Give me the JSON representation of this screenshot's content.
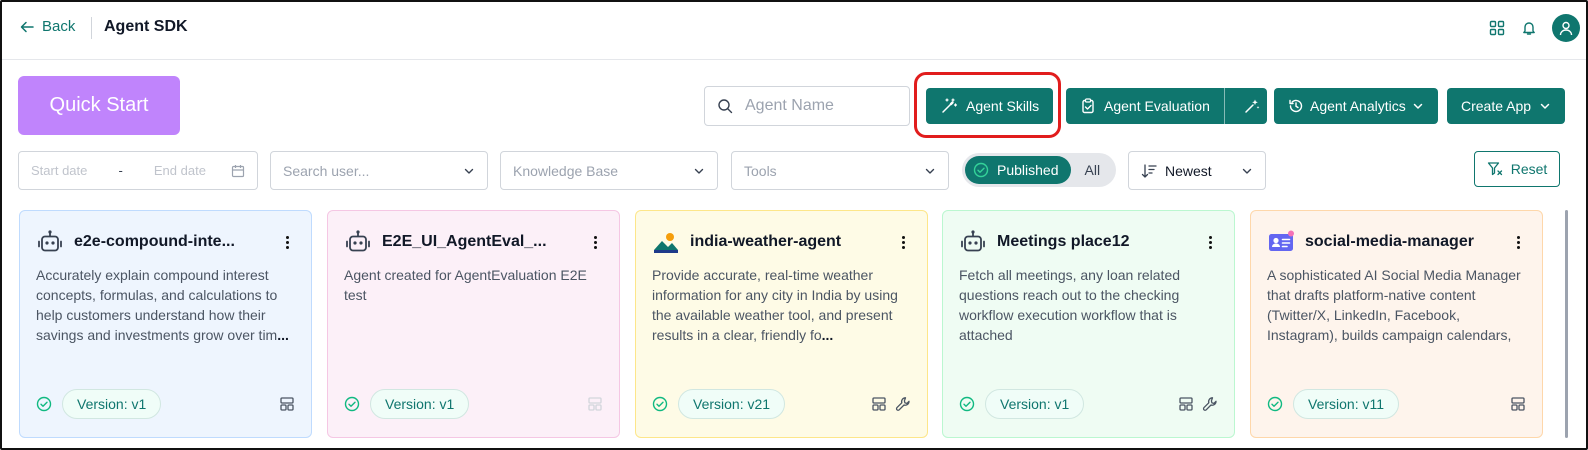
{
  "header": {
    "back_label": "Back",
    "title": "Agent SDK",
    "icons": [
      "grid-icon",
      "bell-icon",
      "user-icon"
    ]
  },
  "toolbar": {
    "quick_start": "Quick Start",
    "search_placeholder": "Agent Name",
    "agent_skills": "Agent Skills",
    "agent_evaluation": "Agent Evaluation",
    "agent_analytics": "Agent Analytics",
    "create_app": "Create App"
  },
  "filters": {
    "start_date_placeholder": "Start date",
    "date_separator": "-",
    "end_date_placeholder": "End date",
    "search_user_placeholder": "Search user...",
    "knowledge_base_placeholder": "Knowledge Base",
    "tools_placeholder": "Tools",
    "toggle_selected": "Published",
    "toggle_other": "All",
    "sort": "Newest",
    "reset": "Reset"
  },
  "cards": [
    {
      "name": "e2e-compound-inte...",
      "description": "Accurately explain compound interest concepts, formulas, and calculations to help customers understand how their savings and investments grow over tim",
      "more": "...",
      "version": "Version: v1",
      "icon": "robot-icon",
      "theme": "blue",
      "has_wrench": false
    },
    {
      "name": "E2E_UI_AgentEval_...",
      "description": "Agent created for AgentEvaluation E2E test",
      "more": "",
      "version": "Version: v1",
      "icon": "robot-icon",
      "theme": "pink",
      "has_wrench": false
    },
    {
      "name": "india-weather-agent",
      "description": "Provide accurate, real-time weather information for any city in India by using the available weather tool, and present results in a clear, friendly fo",
      "more": "...",
      "version": "Version: v21",
      "icon": "landscape-icon",
      "theme": "yellow",
      "has_wrench": true
    },
    {
      "name": "Meetings place12",
      "description": "Fetch all meetings, any loan related questions reach out to the checking workflow execution workflow that is attached",
      "more": "",
      "version": "Version: v1",
      "icon": "robot-icon",
      "theme": "green",
      "has_wrench": true
    },
    {
      "name": "social-media-manager",
      "description": "A sophisticated AI Social Media Manager that drafts platform-native content (Twitter/X, LinkedIn, Facebook, Instagram), builds campaign calendars, cla",
      "more": "...",
      "version": "Version: v11",
      "icon": "id-card-icon",
      "theme": "orange",
      "has_wrench": false
    }
  ],
  "colors": {
    "accent": "#0f766e",
    "quick_start": "#c084fc",
    "highlight": "#e11d1d"
  }
}
